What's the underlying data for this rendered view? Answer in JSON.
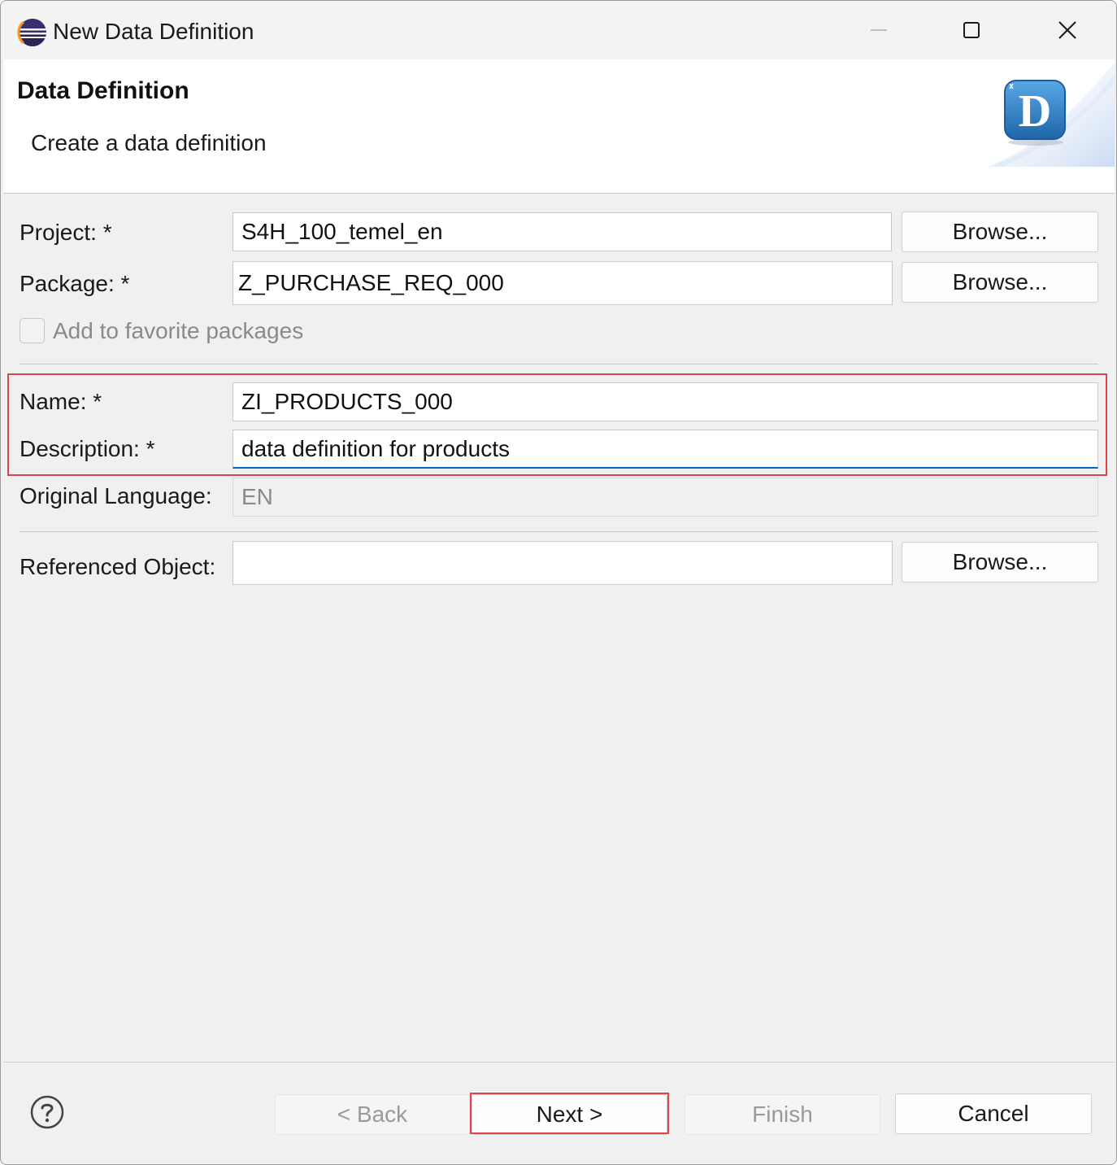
{
  "window": {
    "title": "New Data Definition"
  },
  "banner": {
    "title": "Data Definition",
    "subtitle": "Create a data definition",
    "logo_letter": "D"
  },
  "form": {
    "project_label": "Project: *",
    "project_value": "S4H_100_temel_en",
    "package_label": "Package: *",
    "package_value": "Z_PURCHASE_REQ_000",
    "browse_label": "Browse...",
    "favorite_label": "Add to favorite packages",
    "favorite_checked": false,
    "name_label": "Name: *",
    "name_value": "ZI_PRODUCTS_000",
    "description_label": "Description: *",
    "description_value": "data definition for products",
    "language_label": "Original Language:",
    "language_value": "EN",
    "referenced_label": "Referenced Object:",
    "referenced_value": ""
  },
  "footer": {
    "back_label": "< Back",
    "next_label": "Next >",
    "finish_label": "Finish",
    "cancel_label": "Cancel"
  },
  "colors": {
    "highlight": "#e0444b",
    "focus": "#0067c0",
    "logo_blue": "#2e7fc4"
  }
}
